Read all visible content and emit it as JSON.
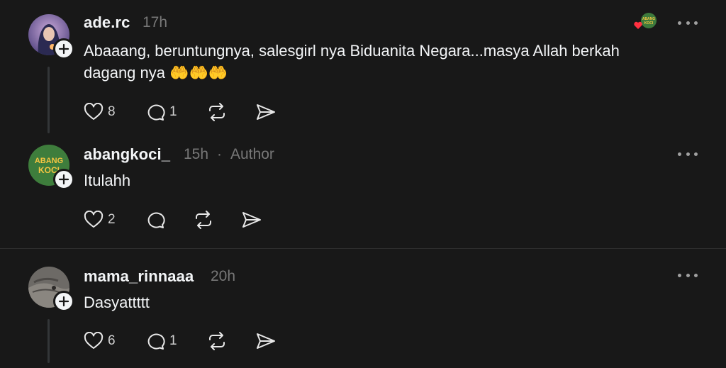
{
  "posts": [
    {
      "username": "ade.rc",
      "time": "17h",
      "author_tag": "",
      "text_line1": "Abaaang, beruntungnya, salesgirl nya Biduanita Negara...masya Allah berkah",
      "text_line2": "dagang nya 🤲🤲🤲",
      "likes": "8",
      "replies": "1"
    },
    {
      "username": "abangkoci_",
      "time": "15h",
      "separator": "·",
      "author_tag": "Author",
      "text_line1": "Itulahh",
      "likes": "2",
      "replies": ""
    },
    {
      "username": "mama_rinnaaa",
      "time": "20h",
      "author_tag": "",
      "text_line1": "Dasyattttt",
      "likes": "6",
      "replies": "1"
    }
  ],
  "logo_text": {
    "line1": "ABANG",
    "line2": "KOCI"
  },
  "colors": {
    "background": "#181818",
    "text": "#f3f5f7",
    "muted": "#777777",
    "like_heart": "#ff3040"
  }
}
